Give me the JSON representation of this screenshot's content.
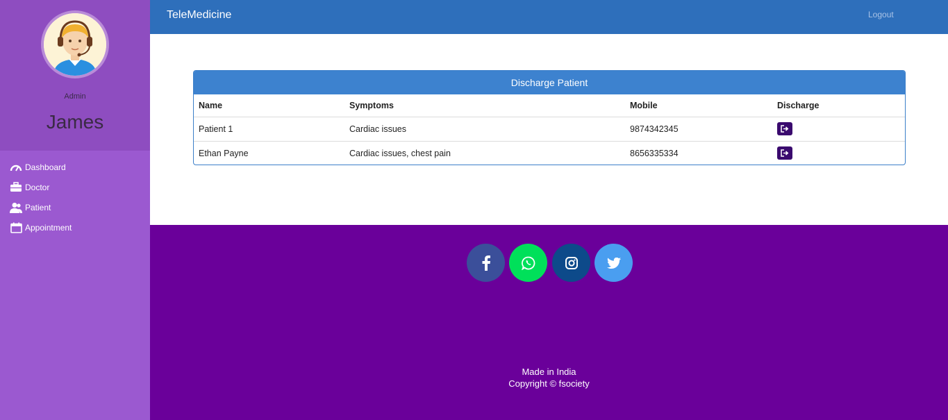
{
  "sidebar": {
    "role": "Admin",
    "username": "James",
    "items": [
      {
        "label": "Dashboard",
        "icon": "speedometer-icon"
      },
      {
        "label": "Doctor",
        "icon": "briefcase-icon"
      },
      {
        "label": "Patient",
        "icon": "users-icon"
      },
      {
        "label": "Appointment",
        "icon": "calendar-icon"
      }
    ]
  },
  "header": {
    "brand": "TeleMedicine",
    "logout": "Logout"
  },
  "panel": {
    "title": "Discharge Patient",
    "columns": [
      "Name",
      "Symptoms",
      "Mobile",
      "Discharge"
    ],
    "rows": [
      {
        "name": "Patient 1",
        "symptoms": "Cardiac issues",
        "mobile": "9874342345"
      },
      {
        "name": "Ethan Payne",
        "symptoms": "Cardiac issues, chest pain",
        "mobile": "8656335334"
      }
    ]
  },
  "footer": {
    "social": [
      {
        "name": "facebook",
        "color": "#3b4f9a"
      },
      {
        "name": "whatsapp",
        "color": "#00e05a"
      },
      {
        "name": "instagram",
        "color": "#0d4a8a"
      },
      {
        "name": "twitter",
        "color": "#4a9ef0"
      }
    ],
    "made_in": "Made in India",
    "copyright": "Copyright © fsociety"
  },
  "colors": {
    "sidebar": "#9b59d0",
    "header": "#2e6fbb",
    "footer": "#6a009a",
    "discharge_button": "#3a0a6e"
  }
}
